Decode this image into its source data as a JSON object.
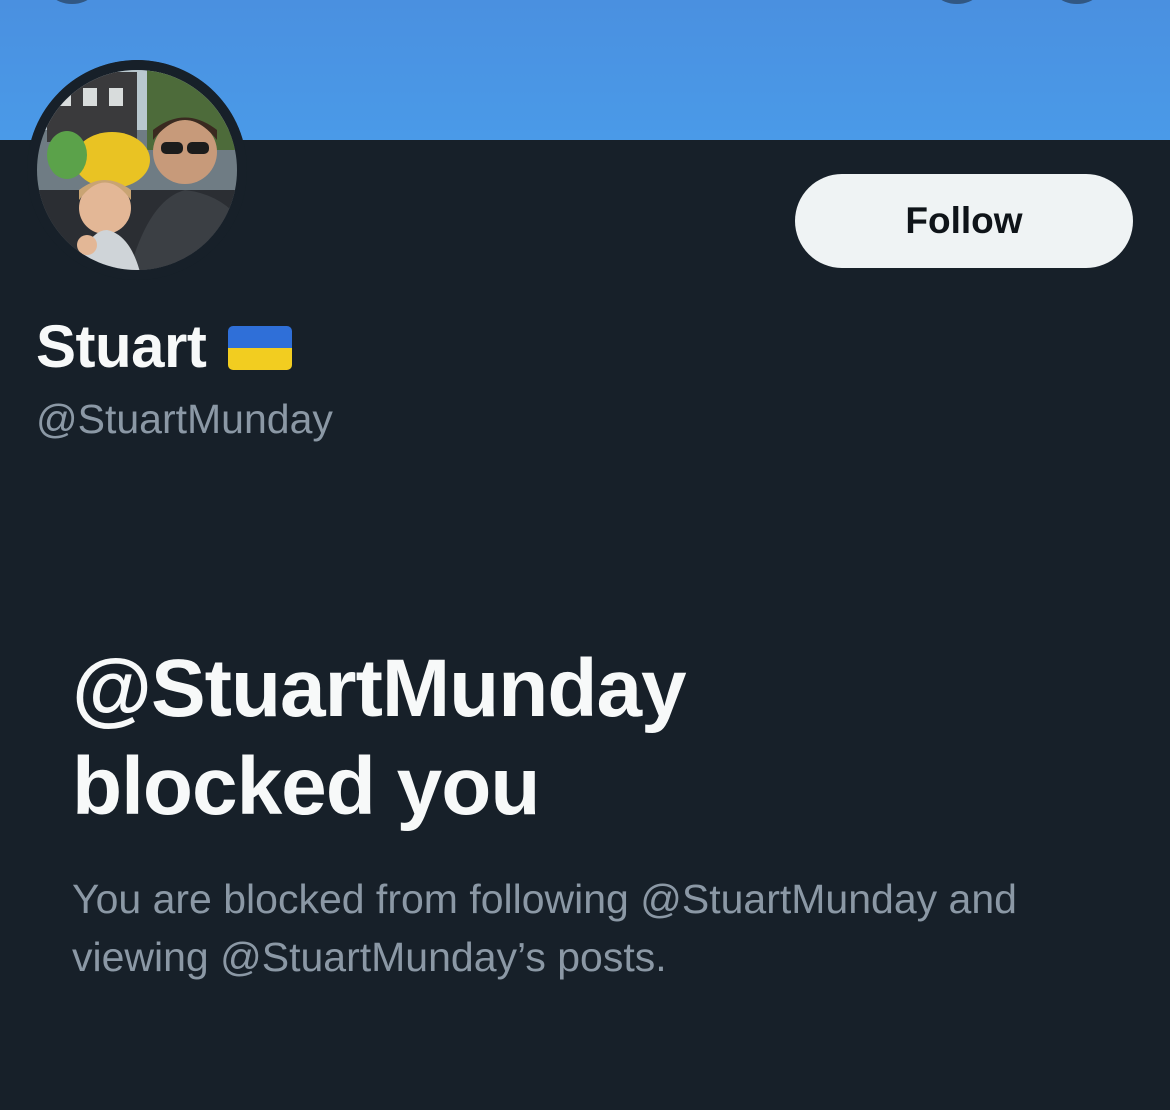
{
  "profile": {
    "display_name": "Stuart",
    "flag_icon": "ukraine-flag-icon",
    "handle": "@StuartMunday",
    "follow_label": "Follow"
  },
  "blocked": {
    "title_line1": "@StuartMunday",
    "title_line2": "blocked you",
    "description": "You are blocked from following @StuartMunday and viewing @StuartMunday’s posts."
  },
  "colors": {
    "banner": "#4a96e6",
    "background": "#172029",
    "primary_text": "#f7f9f9",
    "secondary_text": "#8b98a5",
    "follow_button_bg": "#eff3f4"
  }
}
